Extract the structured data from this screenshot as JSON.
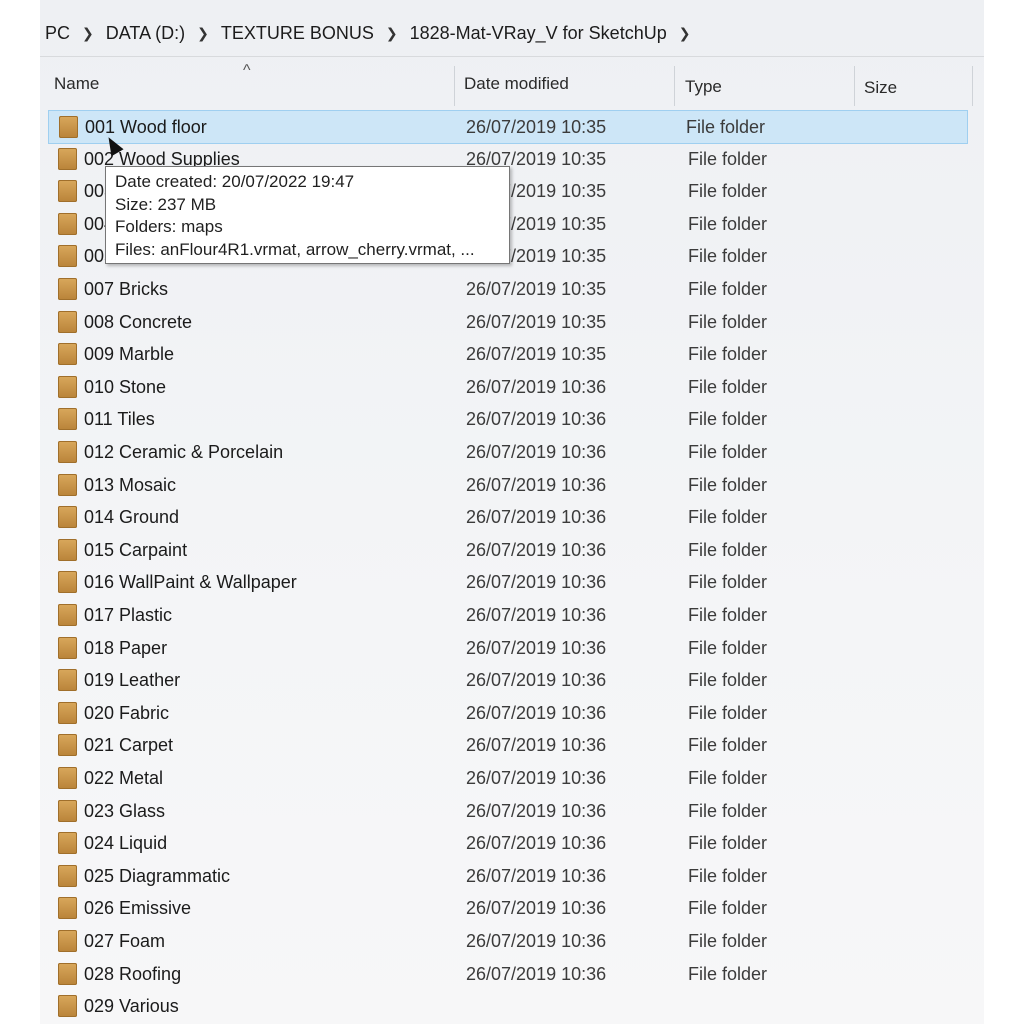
{
  "breadcrumb": [
    "PC",
    "DATA (D:)",
    "TEXTURE BONUS",
    "1828-Mat-VRay_V for SketchUp"
  ],
  "breadcrumb_sep_icon": "chevron-right-icon",
  "columns": {
    "name": "Name",
    "date": "Date modified",
    "type": "Type",
    "size": "Size",
    "sort_icon": "sort-ascending-icon"
  },
  "rows": [
    {
      "name": "001 Wood floor",
      "date": "26/07/2019 10:35",
      "type": "File folder"
    },
    {
      "name": "002 Wood Supplies",
      "date": "26/07/2019 10:35",
      "type": "File folder"
    },
    {
      "name": "003",
      "date": "26/07/2019 10:35",
      "type": "File folder"
    },
    {
      "name": "004",
      "date": "26/07/2019 10:35",
      "type": "File folder"
    },
    {
      "name": "005",
      "date": "26/07/2019 10:35",
      "type": "File folder"
    },
    {
      "name": "007 Bricks",
      "date": "26/07/2019 10:35",
      "type": "File folder"
    },
    {
      "name": "008 Concrete",
      "date": "26/07/2019 10:35",
      "type": "File folder"
    },
    {
      "name": "009 Marble",
      "date": "26/07/2019 10:35",
      "type": "File folder"
    },
    {
      "name": "010 Stone",
      "date": "26/07/2019 10:36",
      "type": "File folder"
    },
    {
      "name": "011 Tiles",
      "date": "26/07/2019 10:36",
      "type": "File folder"
    },
    {
      "name": "012 Ceramic & Porcelain",
      "date": "26/07/2019 10:36",
      "type": "File folder"
    },
    {
      "name": "013 Mosaic",
      "date": "26/07/2019 10:36",
      "type": "File folder"
    },
    {
      "name": "014 Ground",
      "date": "26/07/2019 10:36",
      "type": "File folder"
    },
    {
      "name": "015 Carpaint",
      "date": "26/07/2019 10:36",
      "type": "File folder"
    },
    {
      "name": "016 WallPaint & Wallpaper",
      "date": "26/07/2019 10:36",
      "type": "File folder"
    },
    {
      "name": "017 Plastic",
      "date": "26/07/2019 10:36",
      "type": "File folder"
    },
    {
      "name": "018 Paper",
      "date": "26/07/2019 10:36",
      "type": "File folder"
    },
    {
      "name": "019 Leather",
      "date": "26/07/2019 10:36",
      "type": "File folder"
    },
    {
      "name": "020 Fabric",
      "date": "26/07/2019 10:36",
      "type": "File folder"
    },
    {
      "name": "021 Carpet",
      "date": "26/07/2019 10:36",
      "type": "File folder"
    },
    {
      "name": "022 Metal",
      "date": "26/07/2019 10:36",
      "type": "File folder"
    },
    {
      "name": "023 Glass",
      "date": "26/07/2019 10:36",
      "type": "File folder"
    },
    {
      "name": "024 Liquid",
      "date": "26/07/2019 10:36",
      "type": "File folder"
    },
    {
      "name": "025 Diagrammatic",
      "date": "26/07/2019 10:36",
      "type": "File folder"
    },
    {
      "name": "026 Emissive",
      "date": "26/07/2019 10:36",
      "type": "File folder"
    },
    {
      "name": "027 Foam",
      "date": "26/07/2019 10:36",
      "type": "File folder"
    },
    {
      "name": "028 Roofing",
      "date": "26/07/2019 10:36",
      "type": "File folder"
    },
    {
      "name": "029 Various",
      "date": "",
      "type": ""
    }
  ],
  "selected_index": 0,
  "tooltip": {
    "created": "Date created: 20/07/2022 19:47",
    "size": "Size: 237 MB",
    "folders": "Folders: maps",
    "files": "Files: anFlour4R1.vrmat, arrow_cherry.vrmat, ..."
  },
  "colors": {
    "selection_bg": "#cde6f7",
    "selection_border": "#9fcff0",
    "folder": "#c8913f"
  },
  "folder_icon": "folder-icon"
}
